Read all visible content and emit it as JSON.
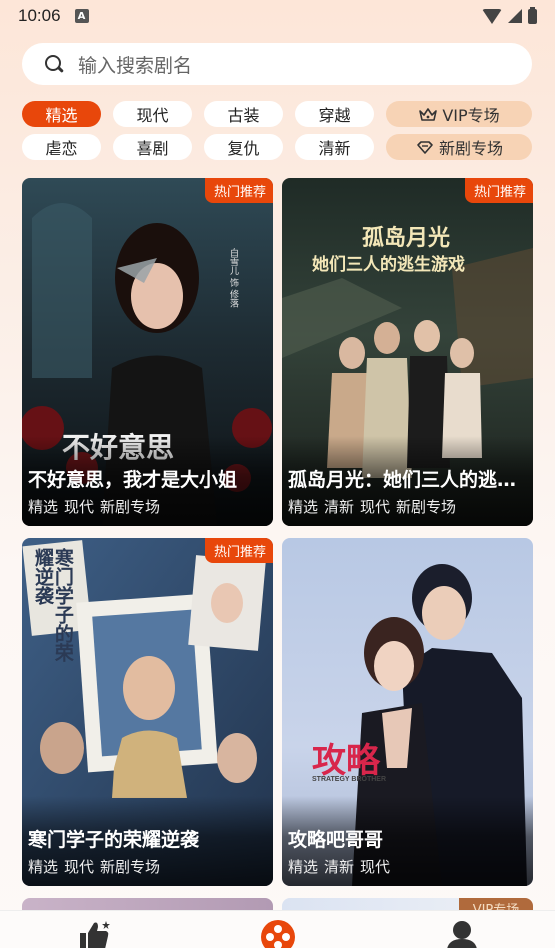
{
  "status_bar": {
    "time": "10:06",
    "notif_letter": "A"
  },
  "search": {
    "placeholder": "输入搜索剧名"
  },
  "chips_row1": [
    {
      "label": "精选",
      "active": true
    },
    {
      "label": "现代"
    },
    {
      "label": "古装"
    },
    {
      "label": "穿越"
    },
    {
      "label": "VIP专场",
      "icon": "crown-icon"
    }
  ],
  "chips_row2": [
    {
      "label": "虐恋"
    },
    {
      "label": "喜剧"
    },
    {
      "label": "复仇"
    },
    {
      "label": "清新"
    },
    {
      "label": "新剧专场",
      "icon": "diamond-icon"
    }
  ],
  "cards": [
    {
      "title": "不好意思，我才是大小姐",
      "tags": [
        "精选",
        "现代",
        "新剧专场"
      ],
      "badge": "热门推荐",
      "poster_text": "不好意思",
      "poster_side_text": "白雪儿 饰 修落"
    },
    {
      "title": "孤岛月光：她们三人的逃生游戏",
      "tags": [
        "精选",
        "清新",
        "现代",
        "新剧专场"
      ],
      "badge": "热门推荐",
      "poster_text": "孤岛月光",
      "poster_subtext": "她们三人的逃生游戏"
    },
    {
      "title": "寒门学子的荣耀逆袭",
      "tags": [
        "精选",
        "现代",
        "新剧专场"
      ],
      "badge": "热门推荐",
      "poster_text": "寒门学子的荣耀逆袭"
    },
    {
      "title": "攻略吧哥哥",
      "tags": [
        "精选",
        "清新",
        "现代"
      ],
      "poster_text": "攻略",
      "poster_subtext": "STRATEGY BROTHER"
    }
  ],
  "peek_badge": "VIP专场",
  "nav": [
    {
      "name": "recommend",
      "icon": "thumbs-up-icon"
    },
    {
      "name": "theater",
      "icon": "film-reel-icon",
      "active": true
    },
    {
      "name": "profile",
      "icon": "person-icon"
    }
  ],
  "colors": {
    "accent": "#e8470b",
    "vip": "#f7d3b5"
  }
}
